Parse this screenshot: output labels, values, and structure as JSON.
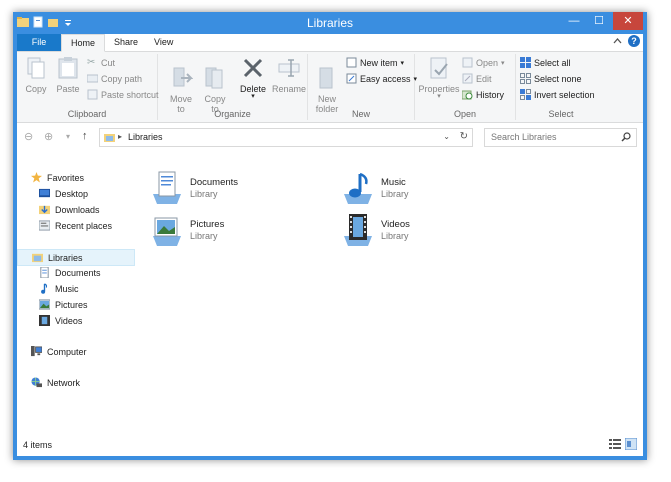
{
  "window": {
    "title": "Libraries",
    "minimize": "—",
    "maximize": "☐",
    "close": "✕"
  },
  "tabs": [
    {
      "label": "File"
    },
    {
      "label": "Home"
    },
    {
      "label": "Share"
    },
    {
      "label": "View"
    }
  ],
  "ribbon": {
    "clipboard": {
      "label": "Clipboard",
      "copy": "Copy",
      "paste": "Paste",
      "cut": "Cut",
      "copy_path": "Copy path",
      "paste_shortcut": "Paste shortcut"
    },
    "organize": {
      "label": "Organize",
      "move_to": "Move\nto",
      "copy_to": "Copy\nto",
      "delete": "Delete",
      "rename": "Rename"
    },
    "new": {
      "label": "New",
      "new_folder": "New\nfolder",
      "new_item": "New item",
      "easy_access": "Easy access"
    },
    "open": {
      "label": "Open",
      "properties": "Properties",
      "open": "Open",
      "edit": "Edit",
      "history": "History"
    },
    "select": {
      "label": "Select",
      "select_all": "Select all",
      "select_none": "Select none",
      "invert_selection": "Invert selection"
    }
  },
  "address": {
    "crumb": "Libraries",
    "search_placeholder": "Search Libraries"
  },
  "navpane": {
    "favorites": "Favorites",
    "desktop": "Desktop",
    "downloads": "Downloads",
    "recent": "Recent places",
    "libraries": "Libraries",
    "documents": "Documents",
    "music": "Music",
    "pictures": "Pictures",
    "videos": "Videos",
    "computer": "Computer",
    "network": "Network"
  },
  "libraries": [
    {
      "name": "Documents",
      "sub": "Library"
    },
    {
      "name": "Music",
      "sub": "Library"
    },
    {
      "name": "Pictures",
      "sub": "Library"
    },
    {
      "name": "Videos",
      "sub": "Library"
    }
  ],
  "status": {
    "count": "4 items"
  },
  "colors": {
    "accent": "#3a8ee0",
    "file_tab": "#1979ca",
    "close": "#c7463c"
  }
}
